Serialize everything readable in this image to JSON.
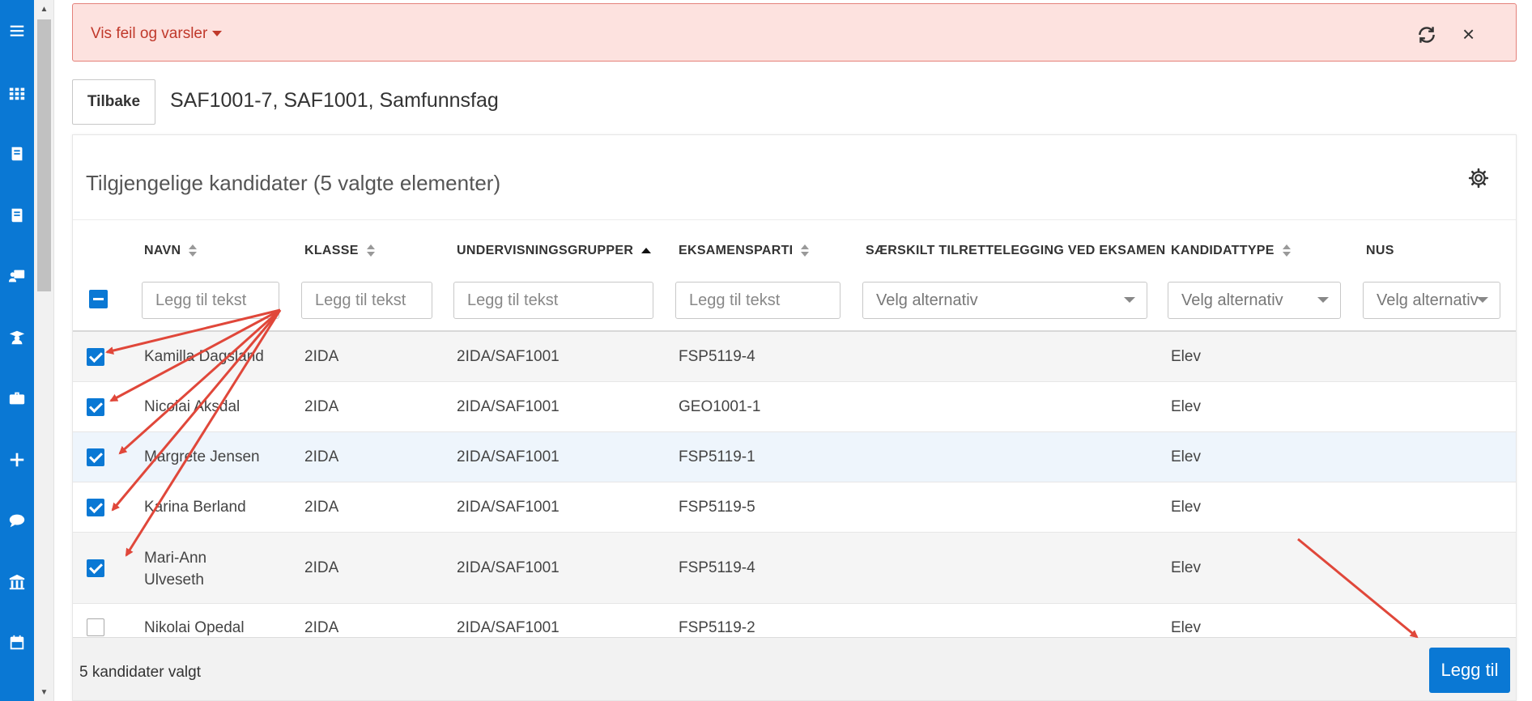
{
  "alert": {
    "text": "Vis feil og varsler"
  },
  "header": {
    "back_label": "Tilbake",
    "title": "SAF1001-7, SAF1001, Samfunnsfag"
  },
  "card": {
    "title": "Tilgjengelige kandidater (5 valgte elementer)"
  },
  "columns": [
    {
      "label": "NAVN",
      "sort": "both",
      "filter_type": "text",
      "placeholder": "Legg til tekst"
    },
    {
      "label": "KLASSE",
      "sort": "both",
      "filter_type": "text",
      "placeholder": "Legg til tekst"
    },
    {
      "label": "UNDERVISNINGSGRUPPER",
      "sort": "asc",
      "filter_type": "text",
      "placeholder": "Legg til tekst"
    },
    {
      "label": "EKSAMENSPARTI",
      "sort": "both",
      "filter_type": "text",
      "placeholder": "Legg til tekst"
    },
    {
      "label": "SÆRSKILT TILRETTELEGGING VED EKSAMEN",
      "sort": "none",
      "filter_type": "select",
      "placeholder": "Velg alternativ"
    },
    {
      "label": "KANDIDATTYPE",
      "sort": "both",
      "filter_type": "select",
      "placeholder": "Velg alternativ"
    },
    {
      "label": "NUS",
      "sort": "none",
      "filter_type": "select",
      "placeholder": "Velg alternativ"
    }
  ],
  "rows": [
    {
      "checked": true,
      "navn": "Kamilla Dagsland",
      "klasse": "2IDA",
      "gruppe": "2IDA/SAF1001",
      "parti": "FSP5119-4",
      "type": "Elev"
    },
    {
      "checked": true,
      "navn": "Nicolai Aksdal",
      "klasse": "2IDA",
      "gruppe": "2IDA/SAF1001",
      "parti": "GEO1001-1",
      "type": "Elev"
    },
    {
      "checked": true,
      "navn": "Margrete Jensen",
      "klasse": "2IDA",
      "gruppe": "2IDA/SAF1001",
      "parti": "FSP5119-1",
      "type": "Elev"
    },
    {
      "checked": true,
      "navn": "Karina Berland",
      "klasse": "2IDA",
      "gruppe": "2IDA/SAF1001",
      "parti": "FSP5119-5",
      "type": "Elev"
    },
    {
      "checked": true,
      "navn": "Mari-Ann Ulveseth",
      "klasse": "2IDA",
      "gruppe": "2IDA/SAF1001",
      "parti": "FSP5119-4",
      "type": "Elev"
    },
    {
      "checked": false,
      "navn": "Nikolai Opedal",
      "klasse": "2IDA",
      "gruppe": "2IDA/SAF1001",
      "parti": "FSP5119-2",
      "type": "Elev"
    }
  ],
  "footer": {
    "count_text": "5 kandidater valgt",
    "add_label": "Legg til"
  },
  "colors": {
    "primary": "#0a78d4",
    "alert_bg": "#fde2df",
    "alert_text": "#c0392b",
    "arrow": "#e0473a",
    "row_alt": "#f5f5f5",
    "row_hover": "#eef5fc"
  }
}
